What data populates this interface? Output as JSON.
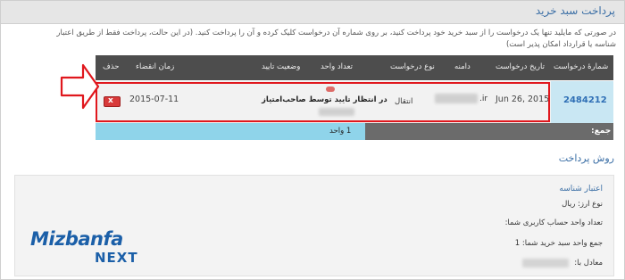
{
  "page": {
    "title": "پرداخت سبد خرید"
  },
  "intro": {
    "line1": "در صورتی که مایلید تنها یک درخواست را از سبد خرید خود پرداخت کنید، بر روی شماره آن درخواست کلیک کرده و آن را پرداخت کنید. (در این حالت، پرداخت فقط از طریق اعتبار",
    "line2": "شناسه یا قرارداد امکان پذیر است)"
  },
  "table": {
    "headers": {
      "request_no": "شمارهٔ درخواست",
      "request_date": "تاریخ درخواست",
      "domain": "دامنه",
      "request_type": "نوع درخواست",
      "units": "تعداد واحد",
      "approval_status": "وضعیت تایید",
      "expiry": "زمان انقضاء",
      "delete": "حذف"
    },
    "row": {
      "request_no": "2484212",
      "request_date": "Jun 26, 2015",
      "domain": ".ir",
      "request_type": "انتقال",
      "units": "(---)",
      "approval_status": "در انتظار تایید توسط صاحب‌امتیاز",
      "expiry": "2015-07-11",
      "delete_icon": "x"
    },
    "total": {
      "label": "جمع:",
      "value": "1 واحد"
    }
  },
  "payment_method": {
    "title": "روش پرداخت",
    "heading": "اعتبار شناسه",
    "currency": "نوع ارز: ریال",
    "account_units": "تعداد واحد حساب کاربری شما:",
    "cart_units": "جمع واحد سبد خرید شما: 1",
    "equivalent": "معادل با:"
  },
  "logo": {
    "brand": "Mizbanfa",
    "suffix": "NEXT"
  },
  "colors": {
    "accent_blue": "#3a6ea5",
    "highlight_red": "#e0171d",
    "header_dark": "#4d4d4d",
    "cyan": "#8fd4ea"
  }
}
